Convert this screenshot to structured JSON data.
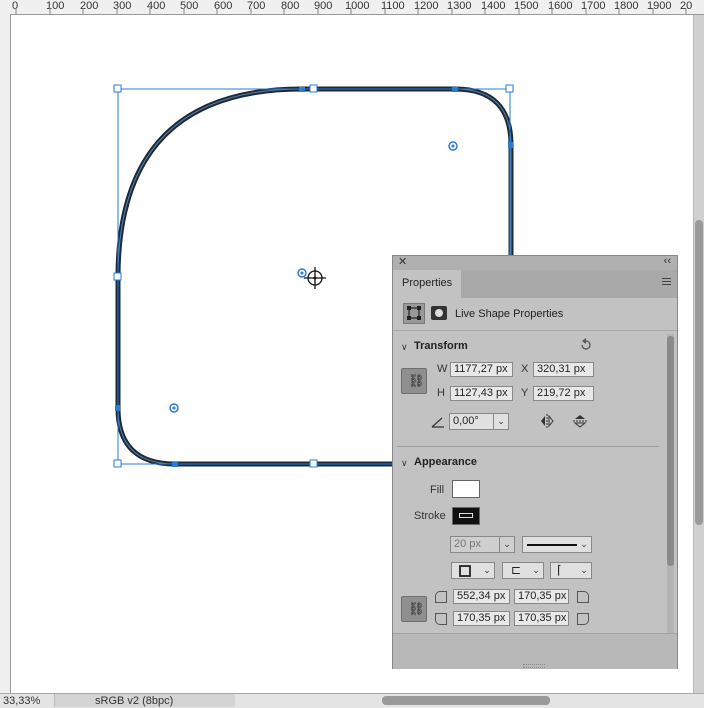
{
  "ruler": {
    "labels": [
      "0",
      "100",
      "200",
      "300",
      "400",
      "500",
      "600",
      "700",
      "800",
      "900",
      "1000",
      "1100",
      "1200",
      "1300",
      "1400",
      "1500",
      "1600",
      "1700",
      "1800",
      "1900",
      "20"
    ]
  },
  "status_bar": {
    "zoom": "33,33%",
    "color_profile": "sRGB v2 (8bpc)"
  },
  "panel": {
    "close_icon": "close-icon",
    "collapse_icon": "double-chevron-left-icon",
    "tab_label": "Properties",
    "live_shape_label": "Live Shape Properties",
    "transform": {
      "title": "Transform",
      "w_label": "W",
      "w_value": "1177,27 px",
      "h_label": "H",
      "h_value": "1127,43 px",
      "x_label": "X",
      "x_value": "320,31 px",
      "y_label": "Y",
      "y_value": "219,72 px",
      "angle_value": "0,00°"
    },
    "appearance": {
      "title": "Appearance",
      "fill_label": "Fill",
      "fill_color": "#ffffff",
      "stroke_label": "Stroke",
      "stroke_color": "#111111",
      "stroke_width": "20 px",
      "corner_tl": "552,34 px",
      "corner_tr": "170,35 px",
      "corner_bl": "170,35 px",
      "corner_br": "170,35 px"
    }
  },
  "colors": {
    "selection": "#2a7bd4",
    "shape_stroke": "#1a2a3a"
  }
}
